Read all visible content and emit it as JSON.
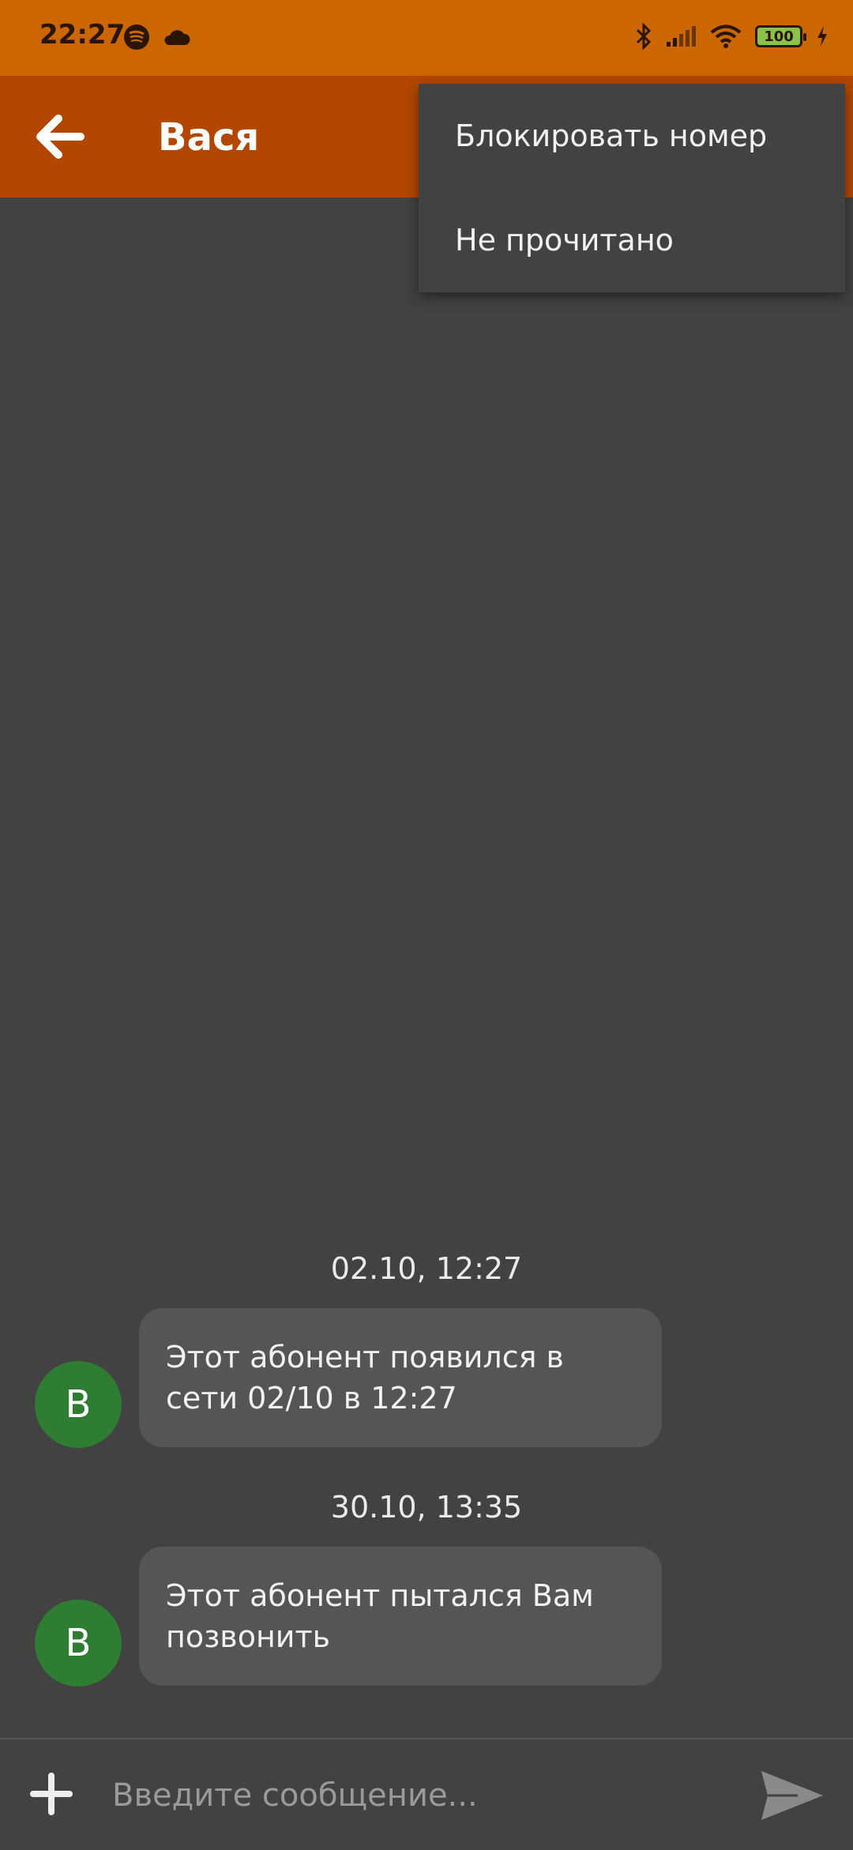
{
  "status_bar": {
    "time": "22:27",
    "battery_level": "100",
    "icons": [
      "spotify-icon",
      "cloud-icon",
      "bluetooth-icon",
      "signal-icon",
      "wifi-icon",
      "battery-icon",
      "charging-icon"
    ]
  },
  "app_bar": {
    "title": "Вася",
    "back_icon": "arrow-left-icon"
  },
  "menu": {
    "items": [
      {
        "label": "Блокировать номер"
      },
      {
        "label": "Не прочитано"
      }
    ]
  },
  "messages": [
    {
      "timestamp": "02.10, 12:27",
      "avatar_letter": "В",
      "text": "Этот абонент появился в сети 02/10 в 12:27"
    },
    {
      "timestamp": "30.10, 13:35",
      "avatar_letter": "В",
      "text": "Этот абонент пытался Вам позвонить"
    }
  ],
  "composer": {
    "placeholder": "Введите сообщение...",
    "attach_icon": "plus-icon",
    "send_icon": "send-icon"
  },
  "colors": {
    "status_bar": "#cc6600",
    "app_bar": "#b34700",
    "background": "#424242",
    "bubble": "#555555",
    "avatar": "#2e7d32"
  }
}
